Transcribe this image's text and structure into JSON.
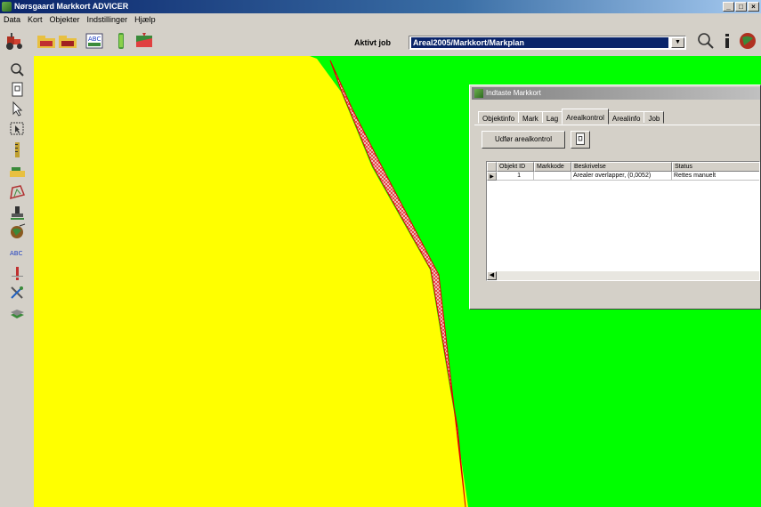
{
  "window": {
    "title": "Nørsgaard Markkort ADVICER",
    "buttons": [
      "_",
      "□",
      "×"
    ]
  },
  "menu": [
    "Data",
    "Kort",
    "Objekter",
    "Indstillinger",
    "Hjælp"
  ],
  "toolbar": {
    "aktivt_job_label": "Aktivt job",
    "job_value": "Areal2005/Markkort/Markplan"
  },
  "dialog": {
    "title": "Indtaste Markkort",
    "tabs": [
      "Objektinfo",
      "Mark",
      "Lag",
      "Arealkontrol",
      "Arealinfo",
      "Job"
    ],
    "active_tab": "Arealkontrol",
    "run_button": "Udfør arealkontrol",
    "table": {
      "columns": [
        "Objekt ID",
        "Markkode",
        "Beskrivelse",
        "Status"
      ],
      "rows": [
        {
          "objekt_id": "1",
          "markkode": "",
          "beskrivelse": "Arealer overlapper, (0,0052)",
          "status": "Rettes manuelt"
        }
      ]
    }
  },
  "colors": {
    "field_yellow": "#ffff00",
    "field_green": "#00ff00",
    "overlap_red": "#e00000"
  }
}
